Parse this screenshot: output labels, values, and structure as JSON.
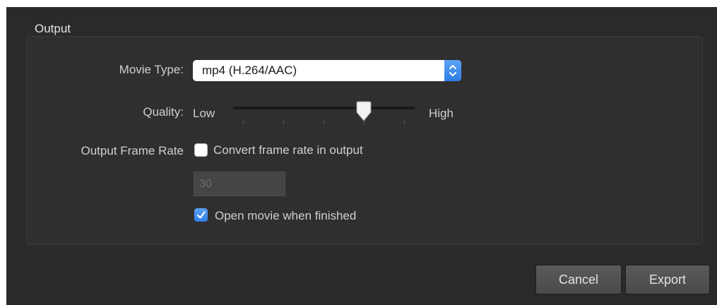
{
  "output_group": {
    "title": "Output"
  },
  "movie_type": {
    "label": "Movie Type:",
    "selected": "mp4 (H.264/AAC)",
    "icon": "popup-arrows-icon",
    "accent_color": "#3a8bee"
  },
  "quality": {
    "label": "Quality:",
    "min_label": "Low",
    "max_label": "High",
    "value_fraction": 0.72,
    "tick_count": 5
  },
  "frame_rate": {
    "label": "Output Frame Rate",
    "checkbox_label": "Convert frame rate in output",
    "checked": false,
    "field_value": "30",
    "field_enabled": false
  },
  "open_movie": {
    "checkbox_label": "Open movie when finished",
    "checked": true
  },
  "buttons": {
    "cancel": "Cancel",
    "export": "Export"
  }
}
